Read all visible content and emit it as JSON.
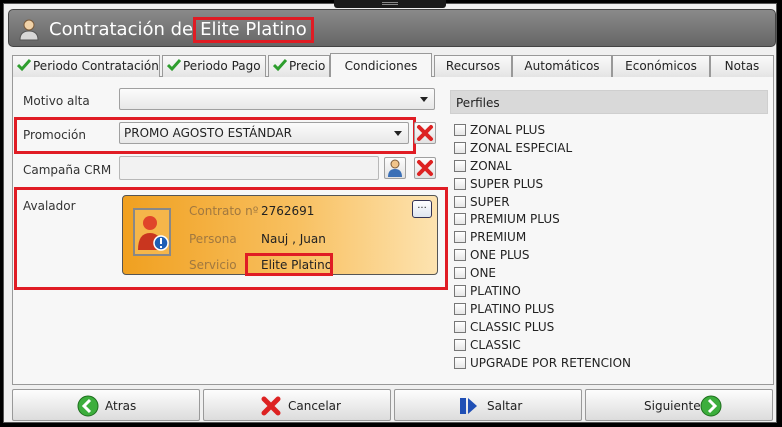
{
  "window": {
    "title_prefix": "Contratación de",
    "title_highlight": "Elite Platino"
  },
  "tabs": [
    {
      "label": "Periodo Contratación",
      "checked": true
    },
    {
      "label": "Periodo Pago",
      "checked": true
    },
    {
      "label": "Precio",
      "checked": true
    },
    {
      "label": "Condiciones",
      "active": true
    },
    {
      "label": "Recursos"
    },
    {
      "label": "Automáticos"
    },
    {
      "label": "Económicos"
    },
    {
      "label": "Notas"
    }
  ],
  "form": {
    "motivo_alta": {
      "label": "Motivo alta",
      "value": ""
    },
    "promocion": {
      "label": "Promoción",
      "value": "PROMO AGOSTO ESTÁNDAR"
    },
    "campana_crm": {
      "label": "Campaña CRM",
      "value": ""
    },
    "avalador": {
      "label": "Avalador",
      "contrato_label": "Contrato nº",
      "contrato_value": "2762691",
      "persona_label": "Persona",
      "persona_value": "Nauj , Juan",
      "servicio_label": "Servicio",
      "servicio_value": "Elite Platino",
      "more_label": "..."
    }
  },
  "perfiles": {
    "header": "Perfiles",
    "items": [
      "ZONAL PLUS",
      "ZONAL ESPECIAL",
      "ZONAL",
      "SUPER PLUS",
      "SUPER",
      "PREMIUM PLUS",
      "PREMIUM",
      "ONE PLUS",
      "ONE",
      "PLATINO",
      "PLATINO PLUS",
      "CLASSIC PLUS",
      "CLASSIC",
      "UPGRADE POR RETENCION"
    ]
  },
  "footer": {
    "atras": "Atras",
    "cancelar": "Cancelar",
    "saltar": "Saltar",
    "siguiente": "Siguiente"
  },
  "colors": {
    "highlight": "#e01c24",
    "check_green": "#2e9e2e",
    "card_orange": "#f0a020"
  }
}
